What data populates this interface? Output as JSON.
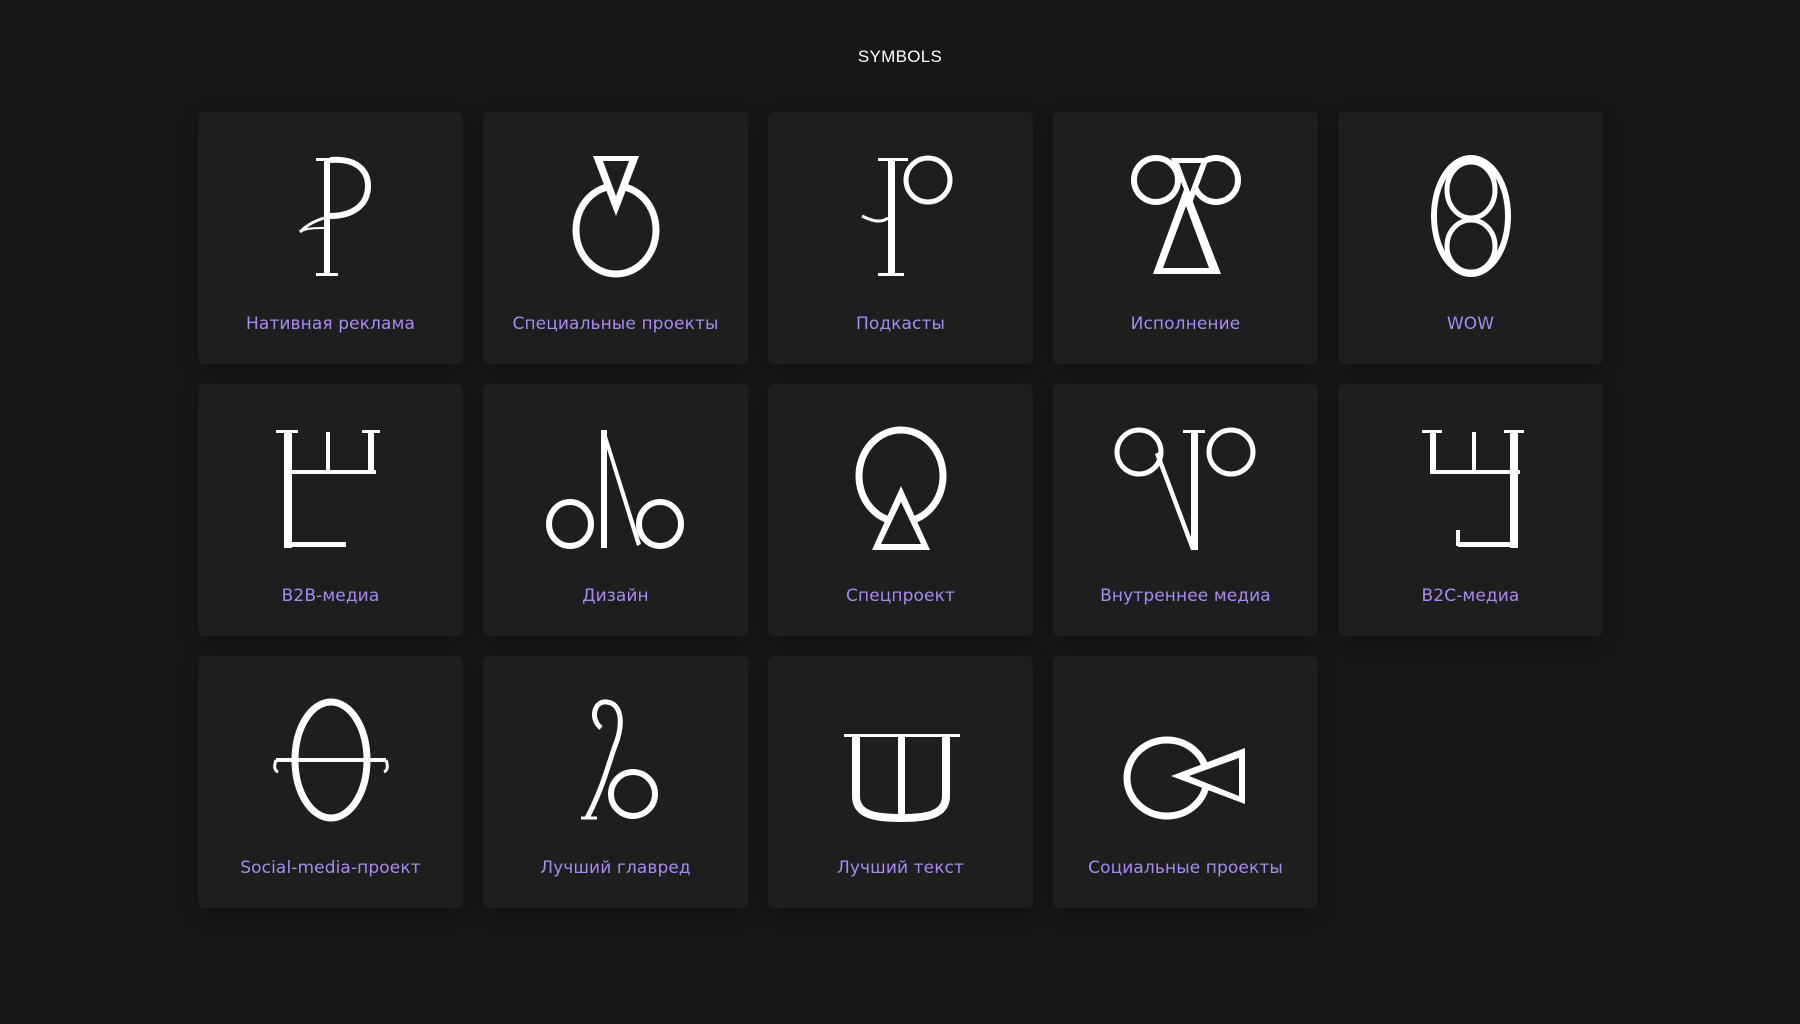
{
  "page": {
    "title": "SYMBOLS"
  },
  "colors": {
    "background": "#171717",
    "card": "#1e1e1e",
    "label": "#a58cf2",
    "glyph": "#ffffff"
  },
  "symbols": [
    {
      "label": "Нативная реклама",
      "icon": "p-glyph-icon"
    },
    {
      "label": "Специальные проекты",
      "icon": "triangle-circle-glyph-icon"
    },
    {
      "label": "Подкасты",
      "icon": "gamma-circle-glyph-icon"
    },
    {
      "label": "Исполнение",
      "icon": "two-circles-triangle-glyph-icon"
    },
    {
      "label": "WOW",
      "icon": "double-oval-glyph-icon"
    },
    {
      "label": "B2B-медиа",
      "icon": "sha-corner-glyph-icon"
    },
    {
      "label": "Дизайн",
      "icon": "two-circles-slash-glyph-icon"
    },
    {
      "label": "Спецпроект",
      "icon": "circle-triangle-glyph-icon"
    },
    {
      "label": "Внутреннее медиа",
      "icon": "circles-v-glyph-icon"
    },
    {
      "label": "B2C-медиа",
      "icon": "reversed-sha-glyph-icon"
    },
    {
      "label": "Social-media-проект",
      "icon": "theta-glyph-icon"
    },
    {
      "label": "Лучший главред",
      "icon": "circle-hook-glyph-icon"
    },
    {
      "label": "Лучший текст",
      "icon": "sha-glyph-icon"
    },
    {
      "label": "Социальные проекты",
      "icon": "circle-arrow-glyph-icon"
    }
  ]
}
